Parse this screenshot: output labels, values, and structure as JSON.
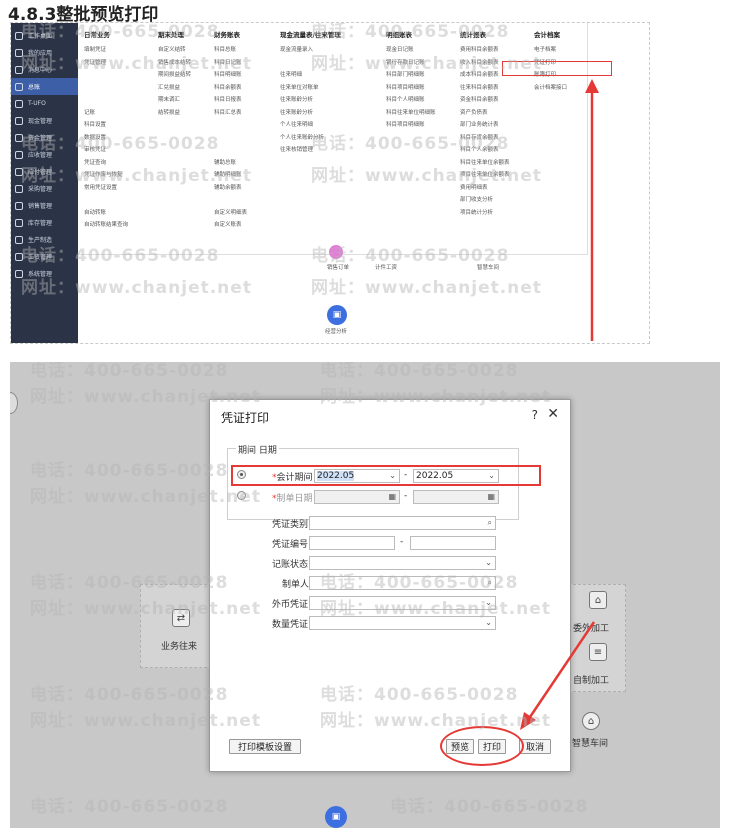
{
  "heading": "4.8.3整批预览打印",
  "watermark": {
    "phone": "电话：400-665-0028",
    "url": "网址：www.chanjet.net"
  },
  "sidebar": {
    "items": [
      {
        "label": "工作桌面"
      },
      {
        "label": "我的应用"
      },
      {
        "label": "消息中心"
      },
      {
        "label": "总账"
      },
      {
        "label": "T-UFO"
      },
      {
        "label": "现金管理"
      },
      {
        "label": "资金管理"
      },
      {
        "label": "应收管理"
      },
      {
        "label": "应付管理"
      },
      {
        "label": "采购管理"
      },
      {
        "label": "销售管理"
      },
      {
        "label": "库存管理"
      },
      {
        "label": "生产制造"
      },
      {
        "label": "工资管理"
      },
      {
        "label": "系统管理"
      }
    ]
  },
  "menu": {
    "columns": [
      {
        "title": "日常业务",
        "items": [
          "填制凭证",
          "凭证管理",
          "",
          "",
          "",
          "记账",
          "科目设置",
          "数据设置",
          "审核凭证",
          "凭证查询",
          "凭证作废与恢复",
          "常用凭证设置",
          "",
          "自动转账",
          "自动转账结果查询"
        ]
      },
      {
        "title": "期末处理",
        "items": [
          "自定义结转",
          "销售成本结转",
          "期间损益结转",
          "汇兑损益",
          "期末调汇",
          "结转损益"
        ]
      },
      {
        "title": "财务账表",
        "items": [
          "科目总账",
          "科目日记账",
          "科目明细账",
          "科目余额表",
          "科目日报表",
          "科目汇总表",
          "",
          "",
          "",
          "辅助总账",
          "辅助明细账",
          "辅助余额表",
          "",
          "自定义明细表",
          "自定义账表"
        ]
      },
      {
        "title": "现金流量表/往来管理",
        "items": [
          "现金流量录入",
          "",
          "往来明细",
          "往来单位对账单",
          "往来账龄分析",
          "往来账龄分析",
          "个人往来明细",
          "个人往来账龄分析",
          "往来核销管理"
        ]
      },
      {
        "title": "明细账表",
        "items": [
          "现金日记账",
          "银行存款日记账",
          "科目部门明细账",
          "科目项目明细账",
          "科目个人明细账",
          "科目往来单位明细账",
          "科目项目明细账"
        ]
      },
      {
        "title": "统计报表",
        "items": [
          "费用科目余额表",
          "收入科目余额表",
          "成本科目余额表",
          "往来科目余额表",
          "资金科目余额表",
          "资产负债表",
          "部门业务统计表",
          "科目存货余额表",
          "科目个人余额表",
          "科目往来单位余额表",
          "项目往来单位余额表",
          "费用明细表",
          "部门收支分析",
          "项目统计分析"
        ]
      },
      {
        "title": "会计档案",
        "items": [
          "电子档案",
          "凭证打印",
          "账簿打印",
          "会计档案接口"
        ]
      }
    ],
    "highlighted": "凭证打印"
  },
  "flow_top": {
    "nodes": [
      "销售订单",
      "计件工资",
      "智慧车间",
      "经营分析"
    ]
  },
  "dialog": {
    "title": "凭证打印",
    "group_legend": "期间 日期",
    "accounting_period_label": "会计期间",
    "period_from": "2022.05",
    "period_to": "2022.05",
    "voucher_date_label": "制单日期",
    "fields": [
      {
        "label": "凭证类别",
        "value": ""
      },
      {
        "label": "凭证编号",
        "value": ""
      },
      {
        "label": "记账状态",
        "value": ""
      },
      {
        "label": "制单人",
        "value": ""
      },
      {
        "label": "外币凭证",
        "value": ""
      },
      {
        "label": "数量凭证",
        "value": ""
      }
    ],
    "buttons": {
      "template_settings": "打印模板设置",
      "preview": "预览",
      "print": "打印",
      "cancel": "取消"
    }
  },
  "flow_bottom": {
    "nodes": [
      {
        "label": "业务往来"
      },
      {
        "label": "委外加工"
      },
      {
        "label": "自制加工"
      },
      {
        "label": "智慧车间"
      }
    ]
  },
  "colors": {
    "sidebar_bg": "#2b3446",
    "accent": "#3d6fe0",
    "annotation_red": "#e53935"
  }
}
